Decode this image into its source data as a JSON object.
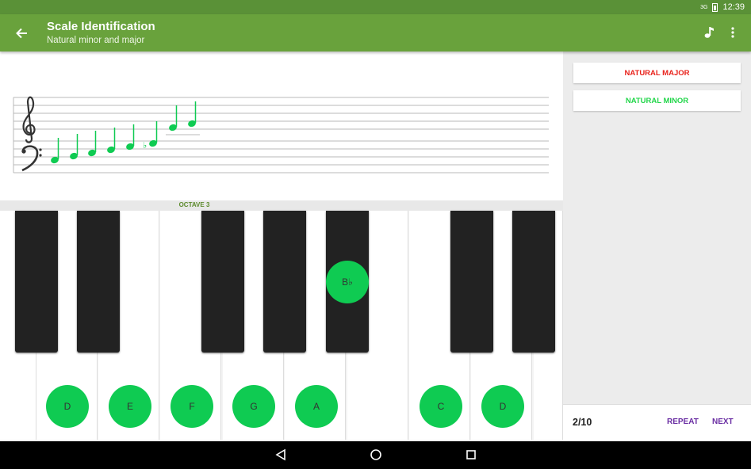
{
  "status": {
    "network": "3G",
    "time": "12:39"
  },
  "appbar": {
    "title": "Scale Identification",
    "subtitle": "Natural minor and major"
  },
  "staff": {
    "note_color": "#0fcb52",
    "accidental": "♭"
  },
  "keyboard": {
    "octave_label": "OCTAVE 3",
    "white_labels": [
      "D",
      "E",
      "F",
      "G",
      "A",
      "C",
      "D"
    ],
    "black_label": "B♭",
    "highlight_color": "#0fcb52"
  },
  "answers": [
    {
      "label": "NATURAL MAJOR",
      "color": "#e8221b"
    },
    {
      "label": "NATURAL MINOR",
      "color": "#22d64a"
    }
  ],
  "footer": {
    "progress": "2/10",
    "repeat_label": "REPEAT",
    "next_label": "NEXT"
  }
}
